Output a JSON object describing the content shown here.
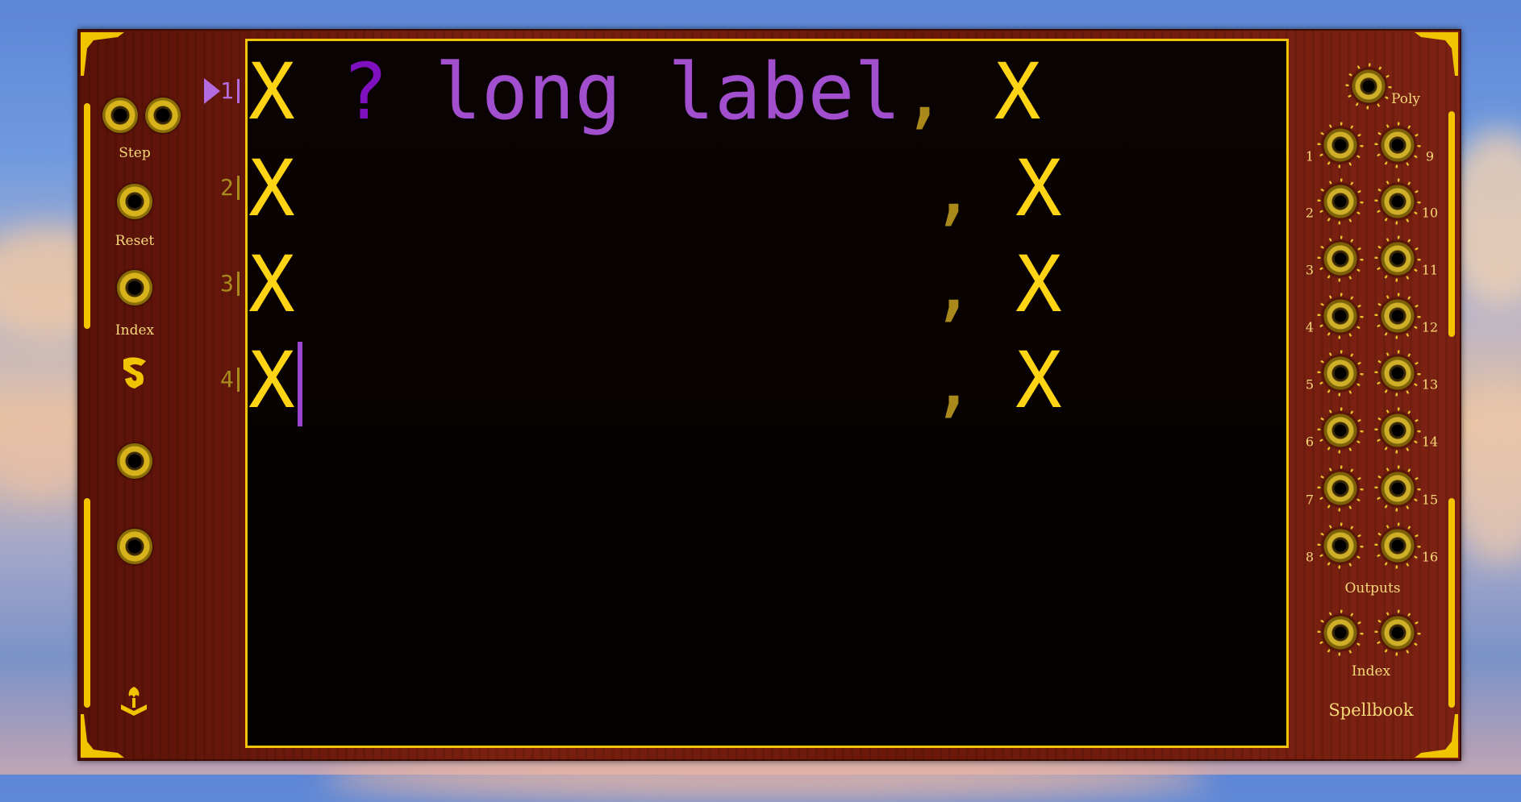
{
  "module": {
    "name": "Spellbook"
  },
  "left_panel": {
    "step_label": "Step",
    "reset_label": "Reset",
    "index_label": "Index"
  },
  "right_panel": {
    "poly_label": "Poly",
    "outputs_label": "Outputs",
    "index_label": "Index",
    "channel_numbers_left": [
      "1",
      "2",
      "3",
      "4",
      "5",
      "6",
      "7",
      "8"
    ],
    "channel_numbers_right": [
      "9",
      "10",
      "11",
      "12",
      "13",
      "14",
      "15",
      "16"
    ]
  },
  "editor": {
    "line_numbers": [
      "1",
      "2",
      "3",
      "4"
    ],
    "active_line": "1",
    "lines": [
      {
        "col1": "X",
        "label_q": "?",
        "label_text": "long label",
        "comma": ",",
        "col2": "X"
      },
      {
        "col1": "X",
        "comma": ",",
        "col2": "X"
      },
      {
        "col1": "X",
        "comma": ",",
        "col2": "X"
      },
      {
        "col1": "X",
        "comma": ",",
        "col2": "X"
      }
    ]
  },
  "colors": {
    "gold": "#f0c400",
    "text_yellow": "#ffd414",
    "label_purple": "#a24fcf",
    "comma_olive": "#a8891a",
    "panel_red": "#6a180a"
  }
}
